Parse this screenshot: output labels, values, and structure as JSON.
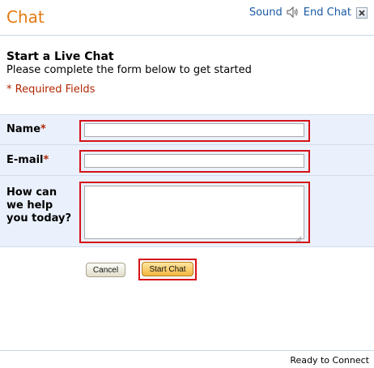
{
  "header": {
    "title": "Chat",
    "sound_label": "Sound",
    "speaker_icon": "speaker-icon",
    "end_chat_label": "End Chat",
    "close_icon": "close-icon",
    "title_color": "#e47911",
    "link_color": "#1a5aa5"
  },
  "intro": {
    "heading": "Start a Live Chat",
    "subtext": "Please complete the form below to get started",
    "required_note": "* Required Fields"
  },
  "form": {
    "name_label": "Name",
    "email_label": "E-mail",
    "required_mark": "*",
    "help_label": "How can we help you today?",
    "name_value": "",
    "email_value": "",
    "help_value": "",
    "highlight_color": "#d5121a"
  },
  "buttons": {
    "cancel_label": "Cancel",
    "start_label": "Start Chat"
  },
  "footer": {
    "status": "Ready to Connect"
  }
}
